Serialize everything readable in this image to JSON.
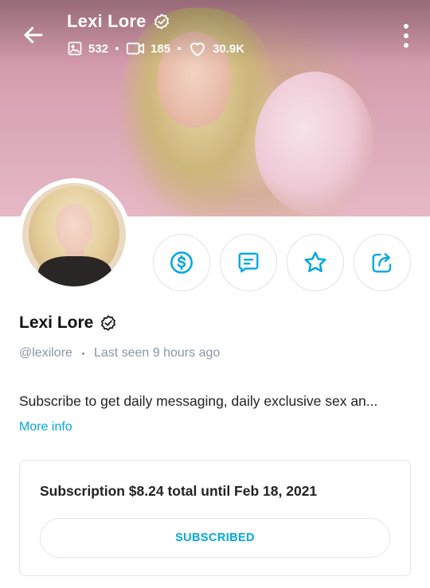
{
  "header": {
    "name": "Lexi Lore",
    "stats": [
      {
        "icon": "image-icon",
        "value": "532"
      },
      {
        "icon": "video-icon",
        "value": "185"
      },
      {
        "icon": "heart-icon",
        "value": "30.9K"
      }
    ]
  },
  "profile": {
    "name": "Lexi Lore",
    "handle": "@lexilore",
    "last_seen": "Last seen 9 hours ago",
    "bio": "Subscribe to get daily messaging, daily exclusive sex an...",
    "more_info": "More info"
  },
  "actions": [
    {
      "icon": "tip-dollar-icon"
    },
    {
      "icon": "message-icon"
    },
    {
      "icon": "star-icon"
    },
    {
      "icon": "share-icon"
    }
  ],
  "subscription": {
    "text": "Subscription $8.24 total until Feb 18, 2021",
    "button": "SUBSCRIBED"
  },
  "colors": {
    "accent": "#00a8e0",
    "muted": "#8a96a3",
    "border": "#e2e6ea"
  }
}
